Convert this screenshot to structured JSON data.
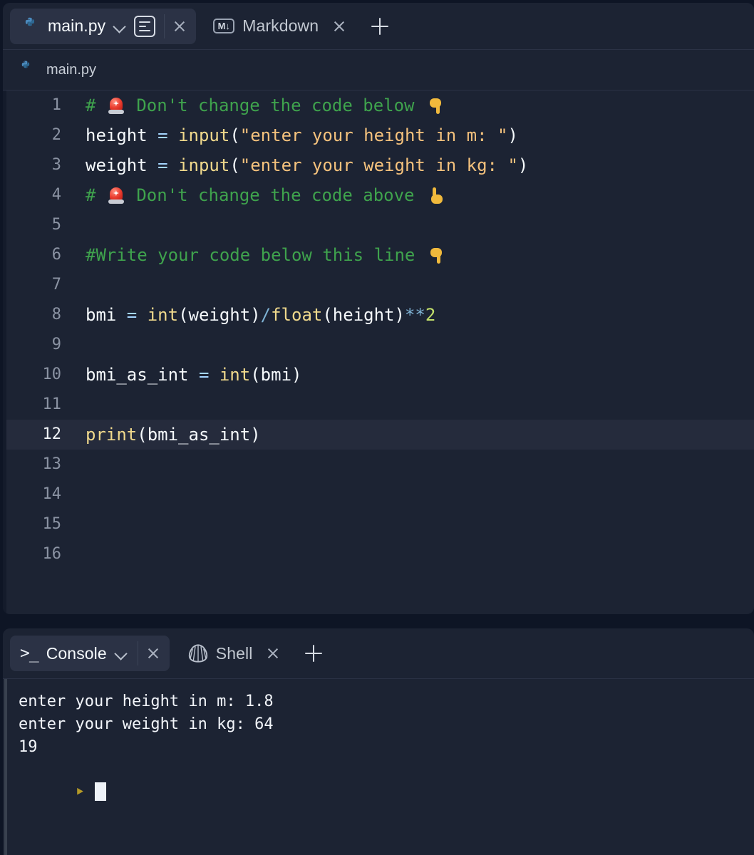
{
  "editor": {
    "tabs": [
      {
        "label": "main.py",
        "icon": "python-icon",
        "active": true,
        "has_dropdown": true,
        "has_preview_toggle": true,
        "closable": true
      },
      {
        "label": "Markdown",
        "icon": "markdown-icon",
        "active": false,
        "has_dropdown": false,
        "has_preview_toggle": false,
        "closable": true
      }
    ],
    "new_tab_label": "+",
    "breadcrumb": {
      "icon": "python-icon",
      "label": "main.py"
    },
    "markdown_icon_text": "M↓",
    "active_line": 12,
    "lines": [
      {
        "n": "1",
        "tokens": [
          {
            "t": "#",
            "c": "cm"
          },
          {
            "t": " ",
            "c": "pun"
          },
          {
            "t": "🚨",
            "c": "emoji-siren"
          },
          {
            "t": " Don't change the code below ",
            "c": "cm"
          },
          {
            "t": "👇",
            "c": "emoji-hand-down"
          }
        ]
      },
      {
        "n": "2",
        "tokens": [
          {
            "t": "height ",
            "c": "pun"
          },
          {
            "t": "=",
            "c": "kw"
          },
          {
            "t": " ",
            "c": "pun"
          },
          {
            "t": "input",
            "c": "fn"
          },
          {
            "t": "(",
            "c": "pun"
          },
          {
            "t": "\"enter your height in m: \"",
            "c": "str"
          },
          {
            "t": ")",
            "c": "pun"
          }
        ]
      },
      {
        "n": "3",
        "tokens": [
          {
            "t": "weight ",
            "c": "pun"
          },
          {
            "t": "=",
            "c": "kw"
          },
          {
            "t": " ",
            "c": "pun"
          },
          {
            "t": "input",
            "c": "fn"
          },
          {
            "t": "(",
            "c": "pun"
          },
          {
            "t": "\"enter your weight in kg: \"",
            "c": "str"
          },
          {
            "t": ")",
            "c": "pun"
          }
        ]
      },
      {
        "n": "4",
        "tokens": [
          {
            "t": "#",
            "c": "cm"
          },
          {
            "t": " ",
            "c": "pun"
          },
          {
            "t": "🚨",
            "c": "emoji-siren"
          },
          {
            "t": " Don't change the code above ",
            "c": "cm"
          },
          {
            "t": "👆",
            "c": "emoji-hand-up"
          }
        ]
      },
      {
        "n": "5",
        "tokens": []
      },
      {
        "n": "6",
        "tokens": [
          {
            "t": "#Write your code below this line ",
            "c": "cm"
          },
          {
            "t": "👇",
            "c": "emoji-hand-down"
          }
        ]
      },
      {
        "n": "7",
        "tokens": []
      },
      {
        "n": "8",
        "tokens": [
          {
            "t": "bmi ",
            "c": "pun"
          },
          {
            "t": "=",
            "c": "kw"
          },
          {
            "t": " ",
            "c": "pun"
          },
          {
            "t": "int",
            "c": "fn"
          },
          {
            "t": "(weight)",
            "c": "pun"
          },
          {
            "t": "/",
            "c": "op"
          },
          {
            "t": "float",
            "c": "fn"
          },
          {
            "t": "(height)",
            "c": "pun"
          },
          {
            "t": "**",
            "c": "op"
          },
          {
            "t": "2",
            "c": "num"
          }
        ]
      },
      {
        "n": "9",
        "tokens": []
      },
      {
        "n": "10",
        "tokens": [
          {
            "t": "bmi_as_int ",
            "c": "pun"
          },
          {
            "t": "=",
            "c": "kw"
          },
          {
            "t": " ",
            "c": "pun"
          },
          {
            "t": "int",
            "c": "fn"
          },
          {
            "t": "(bmi)",
            "c": "pun"
          }
        ]
      },
      {
        "n": "11",
        "tokens": []
      },
      {
        "n": "12",
        "tokens": [
          {
            "t": "print",
            "c": "fn"
          },
          {
            "t": "(bmi_as_int)",
            "c": "pun"
          }
        ]
      },
      {
        "n": "13",
        "tokens": []
      },
      {
        "n": "14",
        "tokens": []
      },
      {
        "n": "15",
        "tokens": []
      },
      {
        "n": "16",
        "tokens": []
      }
    ]
  },
  "console": {
    "tabs": [
      {
        "label": "Console",
        "icon": "terminal-prompt-icon",
        "active": true,
        "has_dropdown": true,
        "closable": true
      },
      {
        "label": "Shell",
        "icon": "shell-icon",
        "active": false,
        "has_dropdown": false,
        "closable": true
      }
    ],
    "new_tab_label": "+",
    "output": [
      "enter your height in m: 1.8",
      "enter your weight in kg: 64",
      "19"
    ],
    "prompt_symbol": "‣",
    "input_value": ""
  },
  "colors": {
    "app_background": "#0e1525",
    "panel_background": "#1c2333",
    "tab_active_background": "#2b3245",
    "active_line_highlight": "#252b3c",
    "comment_green": "#3fa34d",
    "string_orange": "#f5c27d",
    "builtin_yellow": "#f0d98c",
    "operator_blue": "#7fb3d5",
    "number_green": "#c3e06b",
    "text_primary": "#f5f9fc",
    "line_number": "#8b93a3",
    "prompt_gold": "#b59a27"
  }
}
